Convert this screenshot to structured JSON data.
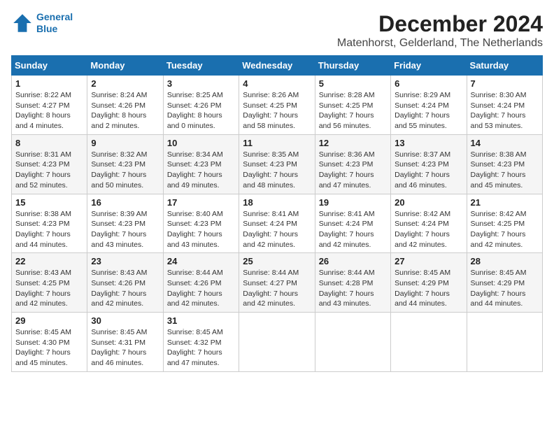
{
  "header": {
    "logo_line1": "General",
    "logo_line2": "Blue",
    "month_title": "December 2024",
    "location": "Matenhorst, Gelderland, The Netherlands"
  },
  "weekdays": [
    "Sunday",
    "Monday",
    "Tuesday",
    "Wednesday",
    "Thursday",
    "Friday",
    "Saturday"
  ],
  "weeks": [
    [
      {
        "day": "1",
        "sunrise": "8:22 AM",
        "sunset": "4:27 PM",
        "daylight": "8 hours and 4 minutes."
      },
      {
        "day": "2",
        "sunrise": "8:24 AM",
        "sunset": "4:26 PM",
        "daylight": "8 hours and 2 minutes."
      },
      {
        "day": "3",
        "sunrise": "8:25 AM",
        "sunset": "4:26 PM",
        "daylight": "8 hours and 0 minutes."
      },
      {
        "day": "4",
        "sunrise": "8:26 AM",
        "sunset": "4:25 PM",
        "daylight": "7 hours and 58 minutes."
      },
      {
        "day": "5",
        "sunrise": "8:28 AM",
        "sunset": "4:25 PM",
        "daylight": "7 hours and 56 minutes."
      },
      {
        "day": "6",
        "sunrise": "8:29 AM",
        "sunset": "4:24 PM",
        "daylight": "7 hours and 55 minutes."
      },
      {
        "day": "7",
        "sunrise": "8:30 AM",
        "sunset": "4:24 PM",
        "daylight": "7 hours and 53 minutes."
      }
    ],
    [
      {
        "day": "8",
        "sunrise": "8:31 AM",
        "sunset": "4:23 PM",
        "daylight": "7 hours and 52 minutes."
      },
      {
        "day": "9",
        "sunrise": "8:32 AM",
        "sunset": "4:23 PM",
        "daylight": "7 hours and 50 minutes."
      },
      {
        "day": "10",
        "sunrise": "8:34 AM",
        "sunset": "4:23 PM",
        "daylight": "7 hours and 49 minutes."
      },
      {
        "day": "11",
        "sunrise": "8:35 AM",
        "sunset": "4:23 PM",
        "daylight": "7 hours and 48 minutes."
      },
      {
        "day": "12",
        "sunrise": "8:36 AM",
        "sunset": "4:23 PM",
        "daylight": "7 hours and 47 minutes."
      },
      {
        "day": "13",
        "sunrise": "8:37 AM",
        "sunset": "4:23 PM",
        "daylight": "7 hours and 46 minutes."
      },
      {
        "day": "14",
        "sunrise": "8:38 AM",
        "sunset": "4:23 PM",
        "daylight": "7 hours and 45 minutes."
      }
    ],
    [
      {
        "day": "15",
        "sunrise": "8:38 AM",
        "sunset": "4:23 PM",
        "daylight": "7 hours and 44 minutes."
      },
      {
        "day": "16",
        "sunrise": "8:39 AM",
        "sunset": "4:23 PM",
        "daylight": "7 hours and 43 minutes."
      },
      {
        "day": "17",
        "sunrise": "8:40 AM",
        "sunset": "4:23 PM",
        "daylight": "7 hours and 43 minutes."
      },
      {
        "day": "18",
        "sunrise": "8:41 AM",
        "sunset": "4:24 PM",
        "daylight": "7 hours and 42 minutes."
      },
      {
        "day": "19",
        "sunrise": "8:41 AM",
        "sunset": "4:24 PM",
        "daylight": "7 hours and 42 minutes."
      },
      {
        "day": "20",
        "sunrise": "8:42 AM",
        "sunset": "4:24 PM",
        "daylight": "7 hours and 42 minutes."
      },
      {
        "day": "21",
        "sunrise": "8:42 AM",
        "sunset": "4:25 PM",
        "daylight": "7 hours and 42 minutes."
      }
    ],
    [
      {
        "day": "22",
        "sunrise": "8:43 AM",
        "sunset": "4:25 PM",
        "daylight": "7 hours and 42 minutes."
      },
      {
        "day": "23",
        "sunrise": "8:43 AM",
        "sunset": "4:26 PM",
        "daylight": "7 hours and 42 minutes."
      },
      {
        "day": "24",
        "sunrise": "8:44 AM",
        "sunset": "4:26 PM",
        "daylight": "7 hours and 42 minutes."
      },
      {
        "day": "25",
        "sunrise": "8:44 AM",
        "sunset": "4:27 PM",
        "daylight": "7 hours and 42 minutes."
      },
      {
        "day": "26",
        "sunrise": "8:44 AM",
        "sunset": "4:28 PM",
        "daylight": "7 hours and 43 minutes."
      },
      {
        "day": "27",
        "sunrise": "8:45 AM",
        "sunset": "4:29 PM",
        "daylight": "7 hours and 44 minutes."
      },
      {
        "day": "28",
        "sunrise": "8:45 AM",
        "sunset": "4:29 PM",
        "daylight": "7 hours and 44 minutes."
      }
    ],
    [
      {
        "day": "29",
        "sunrise": "8:45 AM",
        "sunset": "4:30 PM",
        "daylight": "7 hours and 45 minutes."
      },
      {
        "day": "30",
        "sunrise": "8:45 AM",
        "sunset": "4:31 PM",
        "daylight": "7 hours and 46 minutes."
      },
      {
        "day": "31",
        "sunrise": "8:45 AM",
        "sunset": "4:32 PM",
        "daylight": "7 hours and 47 minutes."
      },
      null,
      null,
      null,
      null
    ]
  ]
}
